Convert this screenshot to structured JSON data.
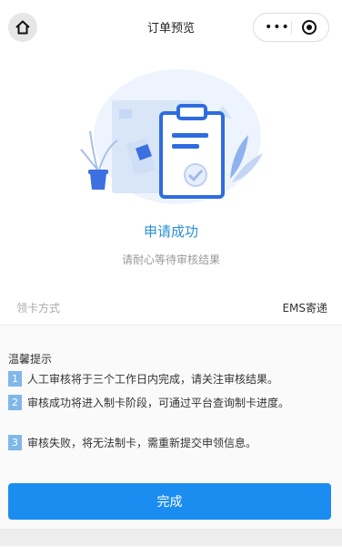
{
  "nav": {
    "title": "订单预览",
    "home_icon": "home-icon",
    "more_icon": "more-dots-icon",
    "close_icon": "target-circle-icon"
  },
  "result": {
    "title": "申请成功",
    "subtitle": "请耐心等待审核结果"
  },
  "method": {
    "label": "领卡方式",
    "value": "EMS寄递"
  },
  "tips": {
    "title": "温馨提示",
    "items": [
      {
        "num": "1",
        "text": "人工审核将于三个工作日内完成，请关注审核结果。"
      },
      {
        "num": "2",
        "text": "审核成功将进入制卡阶段，可通过平台查询制卡进度。"
      },
      {
        "num": "3",
        "text": "审核失败，将无法制卡，需重新提交申领信息。"
      }
    ]
  },
  "button": {
    "label": "完成"
  },
  "colors": {
    "accent": "#1b8df0",
    "success_text": "#2a8fd6",
    "tip_badge": "#7fb7e8"
  }
}
